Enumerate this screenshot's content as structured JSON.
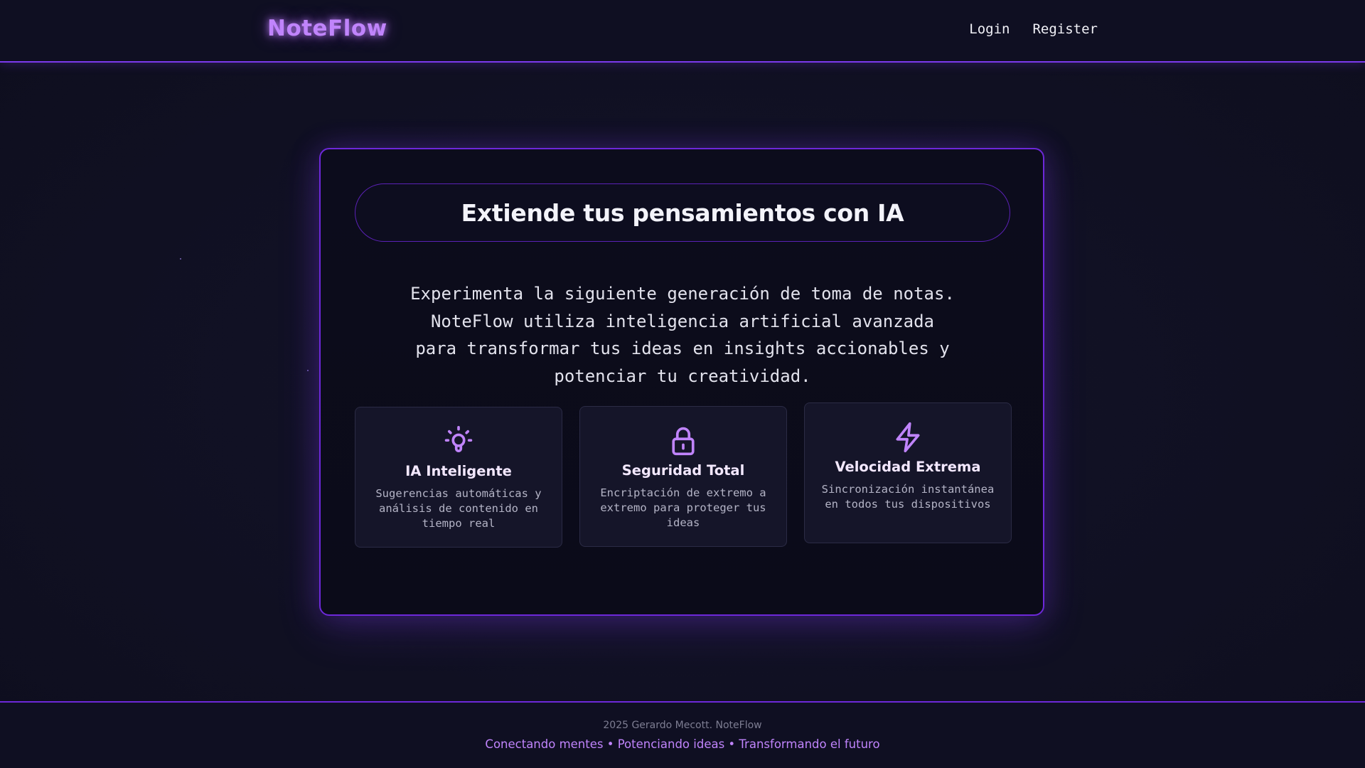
{
  "header": {
    "logo": "NoteFlow",
    "nav": {
      "login": "Login",
      "register": "Register"
    }
  },
  "hero": {
    "title": "Extiende tus pensamientos con IA",
    "description": "Experimenta la siguiente generación de toma de notas.\nNoteFlow utiliza inteligencia artificial avanzada\npara transformar tus ideas en insights accionables y\npotenciar tu creatividad."
  },
  "features": [
    {
      "icon": "lightbulb-icon",
      "title": "IA Inteligente",
      "description": "Sugerencias automáticas y análisis de contenido en tiempo real"
    },
    {
      "icon": "lock-icon",
      "title": "Seguridad Total",
      "description": "Encriptación de extremo a extremo para proteger tus ideas"
    },
    {
      "icon": "lightning-icon",
      "title": "Velocidad Extrema",
      "description": "Sincronización instantánea en todos tus dispositivos"
    }
  ],
  "footer": {
    "copyright": "2025 Gerardo Mecott. NoteFlow",
    "tagline": "Conectando mentes • Potenciando ideas • Transformando el futuro"
  },
  "colors": {
    "accent": "#c084fc",
    "border": "#6d28d9",
    "background": "#111124"
  }
}
